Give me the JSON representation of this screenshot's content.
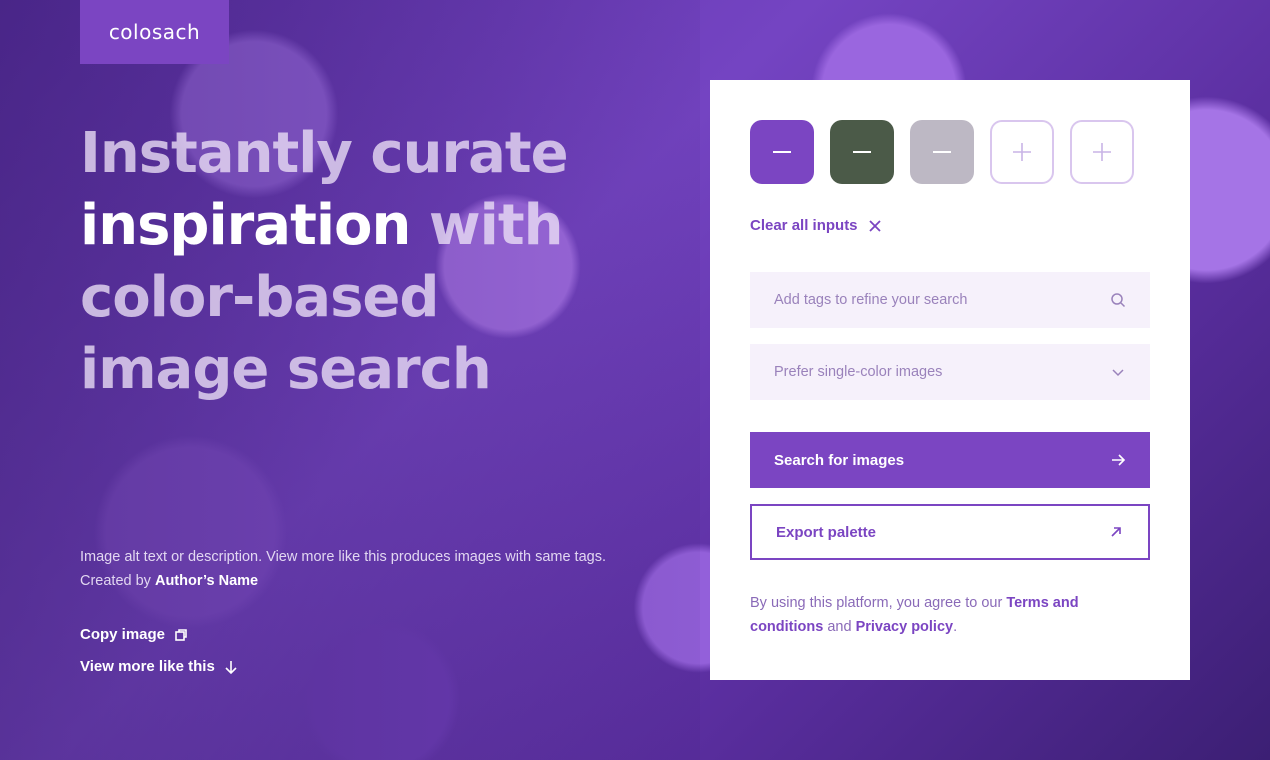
{
  "brand": {
    "logo_text": "colosach",
    "accent_color": "#7b45c2"
  },
  "hero": {
    "headline_part1": "Instantly curate ",
    "headline_strong": "inspiration",
    "headline_part2": " with color-based image search"
  },
  "image_info": {
    "description": "Image alt text or description. View more like this produces images with same tags.",
    "created_by_label": "Created by",
    "author_name": "Author’s Name",
    "copy_label": "Copy image",
    "view_more_label": "View more like this"
  },
  "palette": {
    "swatches": [
      {
        "color": "#7b45c2",
        "state": "filled",
        "icon": "minus-icon"
      },
      {
        "color": "#4b5a48",
        "state": "filled",
        "icon": "minus-icon"
      },
      {
        "color": "#bdb8c4",
        "state": "filled",
        "icon": "minus-icon"
      },
      {
        "color": "#ffffff",
        "state": "empty",
        "icon": "plus-icon"
      },
      {
        "color": "#ffffff",
        "state": "empty",
        "icon": "plus-icon"
      }
    ],
    "clear_label": "Clear all inputs"
  },
  "search": {
    "tags_placeholder": "Add tags to refine your search",
    "tags_value": "",
    "preference_selected": "Prefer single-color images"
  },
  "actions": {
    "search_label": "Search for images",
    "export_label": "Export palette"
  },
  "terms": {
    "prefix": "By using this platform, you agree to our ",
    "terms_link": "Terms and conditions",
    "middle": " and ",
    "privacy_link": "Privacy policy",
    "suffix": "."
  }
}
